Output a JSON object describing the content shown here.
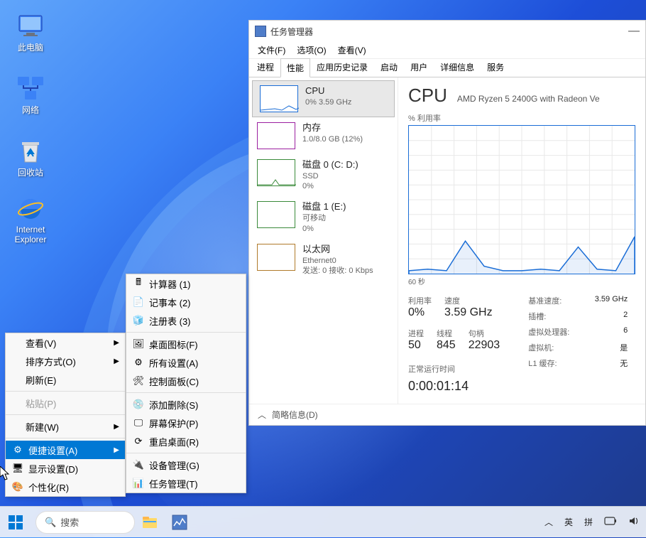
{
  "desktop": {
    "icons": [
      {
        "label": "此电脑",
        "icon": "pc"
      },
      {
        "label": "网络",
        "icon": "network"
      },
      {
        "label": "回收站",
        "icon": "recycle"
      },
      {
        "label": "Internet Explorer",
        "icon": "ie"
      }
    ]
  },
  "context_menu_main": [
    {
      "label": "查看(V)",
      "arrow": true
    },
    {
      "label": "排序方式(O)",
      "arrow": true
    },
    {
      "label": "刷新(E)"
    },
    {
      "sep": true
    },
    {
      "label": "粘贴(P)",
      "disabled": true
    },
    {
      "sep": true
    },
    {
      "label": "新建(W)",
      "arrow": true
    },
    {
      "sep": true
    },
    {
      "label": "便捷设置(A)",
      "arrow": true,
      "highlighted": true,
      "icon": "gear"
    },
    {
      "label": "显示设置(D)",
      "icon": "display"
    },
    {
      "label": "个性化(R)",
      "icon": "personalize"
    }
  ],
  "context_menu_sub": [
    {
      "label": "计算器  (1)",
      "icon": "calc"
    },
    {
      "label": "记事本  (2)",
      "icon": "notepad"
    },
    {
      "label": "注册表  (3)",
      "icon": "regedit"
    },
    {
      "sep": true
    },
    {
      "label": "桌面图标(F)",
      "icon": "desktop-icons"
    },
    {
      "label": "所有设置(A)",
      "icon": "settings"
    },
    {
      "label": "控制面板(C)",
      "icon": "control-panel"
    },
    {
      "sep": true
    },
    {
      "label": "添加删除(S)",
      "icon": "add-remove"
    },
    {
      "label": "屏幕保护(P)",
      "icon": "screensaver"
    },
    {
      "label": "重启桌面(R)",
      "icon": "restart"
    },
    {
      "sep": true
    },
    {
      "label": "设备管理(G)",
      "icon": "device-mgr"
    },
    {
      "label": "任务管理(T)",
      "icon": "task-mgr"
    }
  ],
  "task_manager": {
    "title": "任务管理器",
    "menus": [
      "文件(F)",
      "选项(O)",
      "查看(V)"
    ],
    "tabs": [
      "进程",
      "性能",
      "应用历史记录",
      "启动",
      "用户",
      "详细信息",
      "服务"
    ],
    "active_tab": 1,
    "sidebar": [
      {
        "title": "CPU",
        "sub1": "0% 3.59 GHz",
        "type": "cpu",
        "selected": true
      },
      {
        "title": "内存",
        "sub1": "1.0/8.0 GB (12%)",
        "type": "mem"
      },
      {
        "title": "磁盘 0 (C: D:)",
        "sub1": "SSD",
        "sub2": "0%",
        "type": "disk"
      },
      {
        "title": "磁盘 1 (E:)",
        "sub1": "可移动",
        "sub2": "0%",
        "type": "disk"
      },
      {
        "title": "以太网",
        "sub1": "Ethernet0",
        "sub2": "发送: 0 接收: 0 Kbps",
        "type": "net"
      }
    ],
    "main": {
      "heading": "CPU",
      "subheading": "AMD Ryzen 5 2400G with Radeon Ve",
      "graph_label": "% 利用率",
      "graph_time": "60 秒",
      "stats_left": [
        {
          "label": "利用率",
          "value": "0%"
        },
        {
          "label": "速度",
          "value": "3.59 GHz"
        }
      ],
      "stats_mid": [
        {
          "label": "进程",
          "value": "50"
        },
        {
          "label": "线程",
          "value": "845"
        },
        {
          "label": "句柄",
          "value": "22903"
        }
      ],
      "stats_right": [
        {
          "k": "基准速度:",
          "v": "3.59 GHz"
        },
        {
          "k": "插槽:",
          "v": "2"
        },
        {
          "k": "虚拟处理器:",
          "v": "6"
        },
        {
          "k": "虚拟机:",
          "v": "是"
        },
        {
          "k": "L1 缓存:",
          "v": "无"
        }
      ],
      "uptime_label": "正常运行时间",
      "uptime": "0:00:01:14"
    },
    "footer": "简略信息(D)"
  },
  "taskbar": {
    "search_placeholder": "搜索",
    "tray": {
      "ime": "英",
      "ime2": "拼",
      "chevron": "︿"
    }
  },
  "chart_data": {
    "type": "line",
    "title": "% 利用率",
    "xlabel": "60 秒",
    "ylim": [
      0,
      100
    ],
    "x": [
      0,
      5,
      10,
      15,
      20,
      25,
      30,
      35,
      40,
      45,
      50,
      55,
      60
    ],
    "series": [
      {
        "name": "CPU",
        "values": [
          2,
          3,
          2,
          22,
          5,
          2,
          2,
          3,
          2,
          18,
          3,
          2,
          25
        ]
      }
    ]
  }
}
